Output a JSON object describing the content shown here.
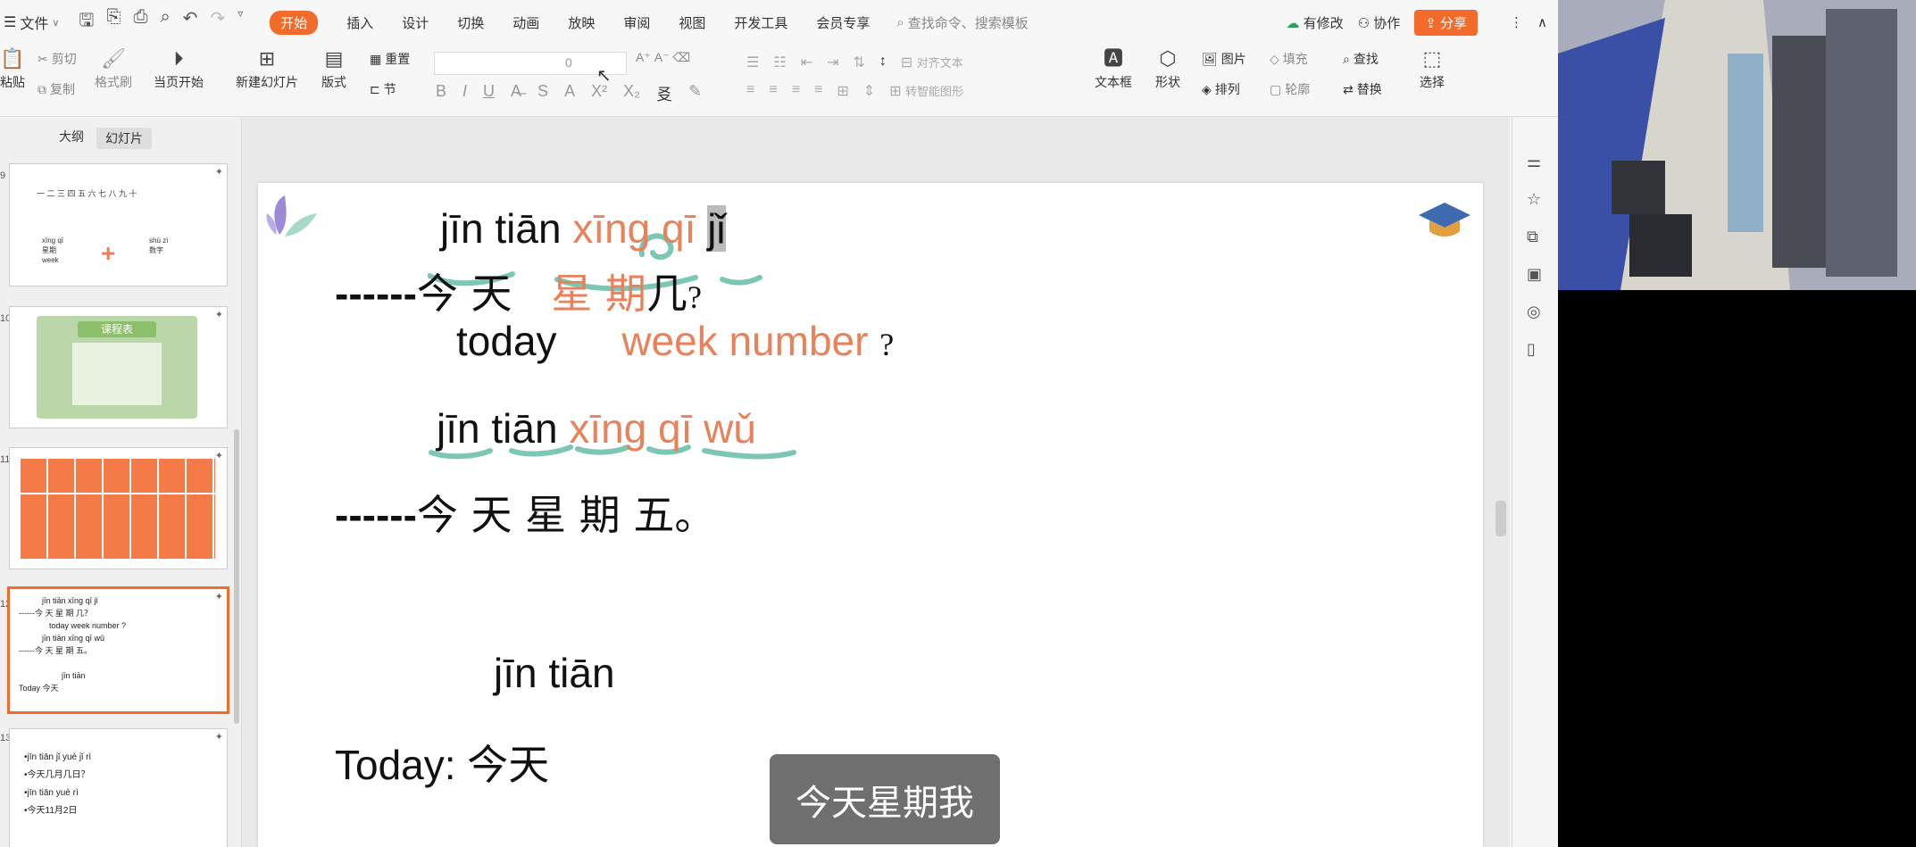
{
  "menubar": {
    "file_label": "文件",
    "tabs": [
      "开始",
      "插入",
      "设计",
      "切换",
      "动画",
      "放映",
      "审阅",
      "视图",
      "开发工具",
      "会员专享"
    ],
    "search_placeholder": "查找命令、搜索模板",
    "modified_label": "有修改",
    "collab_label": "协作",
    "share_label": "分享"
  },
  "ribbon": {
    "paste": "粘贴",
    "cut": "剪切",
    "copy": "复制",
    "format_painter": "格式刷",
    "from_current": "当页开始",
    "new_slide": "新建幻灯片",
    "layout": "版式",
    "section": "节",
    "reset": "重置",
    "font_size": "0",
    "align_text": "对齐文本",
    "smart_shape": "转智能图形",
    "textbox": "文本框",
    "shape": "形状",
    "arrange": "排列",
    "picture": "图片",
    "fill": "填充",
    "outline": "轮廓",
    "find": "查找",
    "replace": "替换",
    "select": "选择"
  },
  "left_panel": {
    "tab_outline": "大纲",
    "tab_slides": "幻灯片",
    "slide_numbers": [
      "9",
      "10",
      "11",
      "12",
      "13"
    ],
    "thumb1": {
      "nums": "一 二 三 四 五 六 七 八 九 十",
      "left": "xīng qī",
      "left2": "星期",
      "left3": "week",
      "right": "shù zì",
      "right2": "数字"
    },
    "thumb2": {
      "title": "课程表"
    },
    "thumb4": {
      "l1": "jīn tiān xīng qī jǐ",
      "l2": "------今 天   星 期 几？",
      "l3": "today   week  number ?",
      "l4": "jīn tiān xīng qī wǔ",
      "l5": "------今 天   星  期 五。",
      "l6": "jīn tiān",
      "l7": "Today  今天"
    },
    "thumb5": {
      "l1": "•jīn tiān jǐ yuè jǐ rì",
      "l2": "•今天几月几日？",
      "l3": "•jīn tiān yuè rì",
      "l4": "•今天11月2日"
    }
  },
  "slide": {
    "p1_a": "jīn tiān",
    "p1_b": "xīng qī",
    "p1_c": "jǐ",
    "h1_dash": "------",
    "h1_a": "今 天",
    "h1_b": "星   期",
    "h1_c": "几",
    "h1_q": "?",
    "e1_a": "today",
    "e1_b": "week  number",
    "e1_q": "?",
    "p2_a": "jīn tiān",
    "p2_b": "xīng qī wǔ",
    "h2_dash": "------",
    "h2_text": "今 天    星   期 五。",
    "p3": "jīn tiān",
    "today": "Today: 今天"
  },
  "caption": "今天星期我"
}
